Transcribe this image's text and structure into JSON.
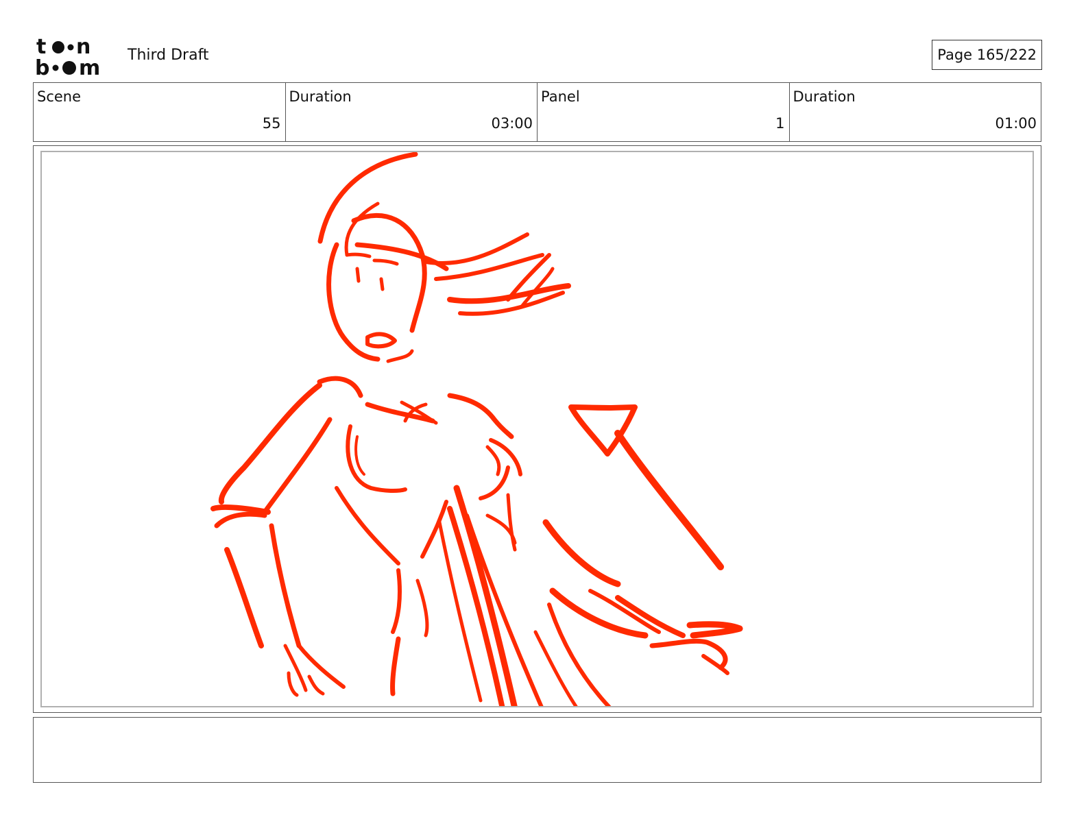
{
  "header": {
    "logo_text": "toon boom",
    "document_title": "Third Draft",
    "page_indicator": "Page 165/222"
  },
  "info": {
    "scene_label": "Scene",
    "scene_value": "55",
    "scene_duration_label": "Duration",
    "scene_duration_value": "03:00",
    "panel_label": "Panel",
    "panel_value": "1",
    "panel_duration_label": "Duration",
    "panel_duration_value": "01:00"
  },
  "panel": {
    "sketch_color": "#ff2a00"
  },
  "notes": {
    "text": ""
  }
}
